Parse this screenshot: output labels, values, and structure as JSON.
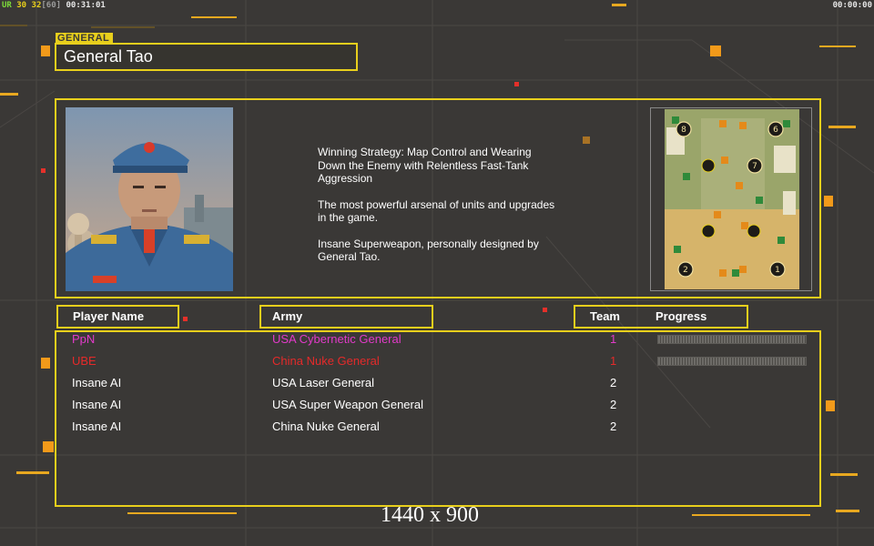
{
  "hud": {
    "left_parts": [
      "UR",
      "30",
      "32",
      "[60]",
      "00:31:01"
    ],
    "right": "00:00:00"
  },
  "general": {
    "label": "GENERAL",
    "name": "General Tao",
    "portrait_icon": "general-tao-portrait"
  },
  "description": [
    "Winning Strategy: Map Control and Wearing\n Down the Enemy with Relentless Fast-Tank\n Aggression",
    "The most powerful arsenal of units and upgrades\n in the game.",
    "Insane Superweapon, personally designed by\n General Tao."
  ],
  "minimap": {
    "icon": "minimap-icon",
    "start_positions": [
      "8",
      "6",
      "7",
      "2",
      "1"
    ]
  },
  "table": {
    "headers": {
      "player": "Player Name",
      "army": "Army",
      "team": "Team",
      "progress": "Progress"
    },
    "rows": [
      {
        "player": "PpN",
        "army": "USA Cybernetic General",
        "team": "1",
        "color": "#e23ac9",
        "progress": true
      },
      {
        "player": "UBE",
        "army": "China Nuke General",
        "team": "1",
        "color": "#e52a2a",
        "progress": true
      },
      {
        "player": "Insane AI",
        "army": "USA Laser General",
        "team": "2",
        "color": "#ffffff",
        "progress": false
      },
      {
        "player": "Insane AI",
        "army": "USA Super Weapon General",
        "team": "2",
        "color": "#ffffff",
        "progress": false
      },
      {
        "player": "Insane AI",
        "army": "China Nuke General",
        "team": "2",
        "color": "#ffffff",
        "progress": false
      }
    ]
  },
  "resolution": "1440 x 900",
  "colors": {
    "frame": "#e8cf1c",
    "background": "#3a3836",
    "accent_orange": "#f2a21a"
  }
}
